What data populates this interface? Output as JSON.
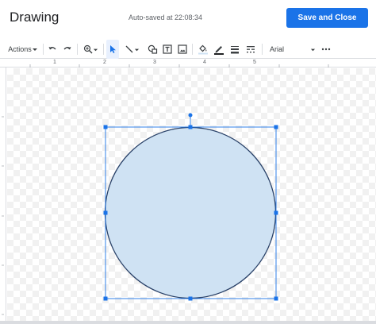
{
  "header": {
    "title": "Drawing",
    "autosave": "Auto-saved at 22:08:34",
    "save_label": "Save and Close"
  },
  "toolbar": {
    "actions_label": "Actions",
    "font_label": "Arial",
    "icons": [
      "undo-icon",
      "redo-icon",
      "zoom-icon",
      "select-icon",
      "line-icon",
      "shape-icon",
      "textbox-icon",
      "image-icon",
      "fill-color-icon",
      "border-color-icon",
      "border-weight-icon",
      "border-dash-icon",
      "more-icon"
    ]
  },
  "ruler": {
    "top_labels": [
      "1",
      "2",
      "3",
      "4",
      "5"
    ]
  },
  "shape": {
    "type": "ellipse",
    "fill": "#cfe2f3",
    "stroke": "#294168",
    "selection_color": "#1a73e8"
  }
}
